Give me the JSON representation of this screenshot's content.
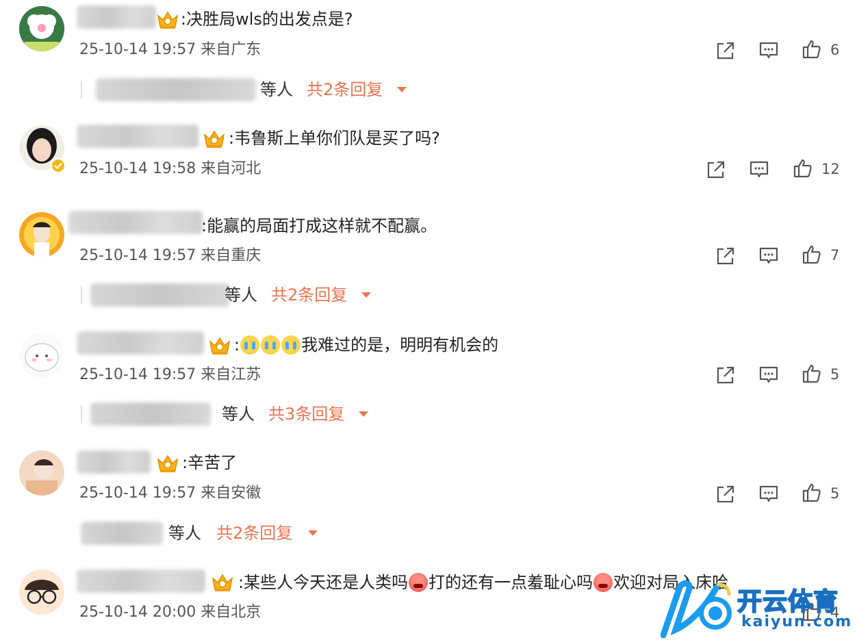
{
  "comments": [
    {
      "text": ":决胜局wls的出发点是?",
      "time": "25-10-14 19:57",
      "location": "来自广东",
      "likes": "6",
      "reply": {
        "who": "等人",
        "count": "共2条回复"
      }
    },
    {
      "text": ":韦鲁斯上单你们队是买了吗?",
      "time": "25-10-14 19:58",
      "location": "来自河北",
      "likes": "12"
    },
    {
      "text": ":能赢的局面打成这样就不配赢。",
      "time": "25-10-14 19:57",
      "location": "来自重庆",
      "likes": "7",
      "reply": {
        "who": "等人",
        "count": "共2条回复"
      }
    },
    {
      "text_prefix": ":",
      "text": "我难过的是，明明有机会的",
      "time": "25-10-14 19:57",
      "location": "来自江苏",
      "likes": "5",
      "reply": {
        "who": "等人",
        "count": "共3条回复"
      }
    },
    {
      "text": ":辛苦了",
      "time": "25-10-14 19:57",
      "location": "来自安徽",
      "likes": "5",
      "reply": {
        "who": "等人",
        "count": "共2条回复"
      }
    },
    {
      "text_a": ":某些人今天还是人类吗",
      "text_b": "打的还有一点羞耻心吗",
      "text_c": "欢迎对局入床哈",
      "time": "25-10-14 20:00",
      "location": "来自北京",
      "likes": "4"
    }
  ],
  "watermark": {
    "name": "开云体育",
    "url": "kaiyun.com"
  },
  "colors": {
    "accent": "#eb7350",
    "text": "#222222",
    "meta": "#555555"
  },
  "icons": [
    "share-icon",
    "comment-icon",
    "like-icon",
    "crown-badge-icon",
    "caret-down-icon"
  ]
}
